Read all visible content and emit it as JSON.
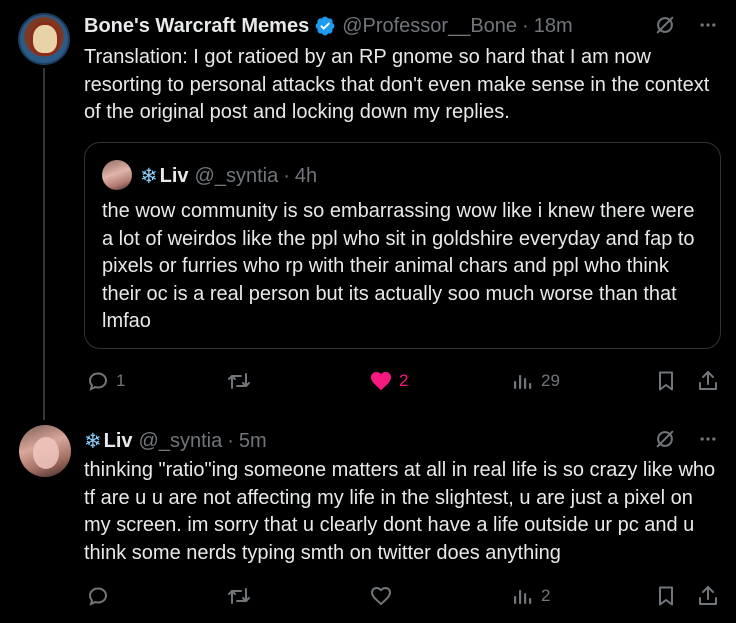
{
  "tweet1": {
    "name": "Bone's Warcraft Memes",
    "handle": "@Professor__Bone",
    "time": "18m",
    "text": "Translation: I got ratioed by an RP gnome so hard that I am now resorting to personal attacks that don't even make sense in the context of the original post and locking down my replies.",
    "quote": {
      "name": "Liv",
      "name_prefix": "❄",
      "handle": "@_syntia",
      "time": "4h",
      "text": "the wow community is so embarrassing wow like i knew there were a lot of weirdos like the ppl who sit in goldshire everyday and fap to pixels or furries who rp with their animal chars and ppl who think their oc is a real person but its actually soo much worse than that lmfao"
    },
    "actions": {
      "replies": "1",
      "retweets": "",
      "likes": "2",
      "views": "29"
    }
  },
  "tweet2": {
    "name": "Liv",
    "name_prefix": "❄",
    "handle": "@_syntia",
    "time": "5m",
    "text": "thinking \"ratio\"ing someone matters at all in real life is so crazy like who tf are u u are not affecting my life in the slightest, u are just a pixel on my screen. im sorry that u clearly dont have a life outside ur pc and u think some nerds typing smth on twitter does anything",
    "actions": {
      "replies": "",
      "retweets": "",
      "likes": "",
      "views": "2"
    }
  },
  "separator": "·",
  "colors": {
    "background": "#000000",
    "text": "#e7e9ea",
    "muted": "#71767b",
    "verified": "#1d9bf0",
    "like": "#f91880",
    "border": "#2f3336"
  }
}
